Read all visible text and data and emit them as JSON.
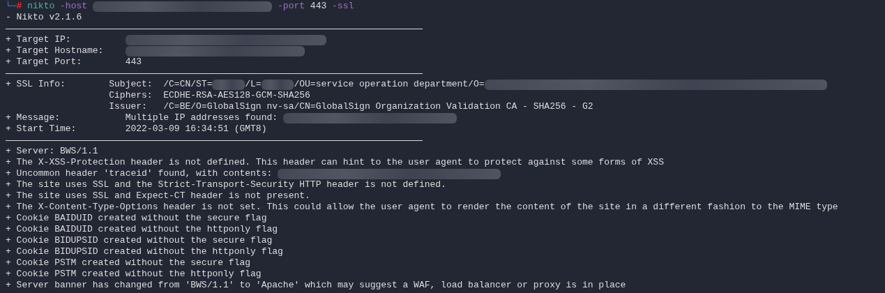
{
  "terminal": {
    "lines": [
      {
        "kind": "command",
        "segments": [
          {
            "kind": "prompt",
            "text": "└─"
          },
          {
            "kind": "root",
            "text": "#"
          },
          {
            "kind": "program",
            "text": " nikto"
          },
          {
            "kind": "option",
            "text": " -host "
          },
          {
            "kind": "redacted"
          },
          {
            "kind": "option",
            "text": " -port"
          },
          {
            "kind": "plain",
            "text": " 443"
          },
          {
            "kind": "option",
            "text": " -ssl"
          }
        ]
      },
      {
        "kind": "text",
        "segments": [
          {
            "kind": "plain",
            "text": "- Nikto v2.1.6"
          }
        ]
      },
      {
        "kind": "rule"
      },
      {
        "kind": "text",
        "segments": [
          {
            "kind": "plain",
            "text": "+ Target IP:          "
          },
          {
            "kind": "redacted"
          }
        ]
      },
      {
        "kind": "text",
        "segments": [
          {
            "kind": "plain",
            "text": "+ Target Hostname:    "
          },
          {
            "kind": "redacted"
          }
        ]
      },
      {
        "kind": "text",
        "segments": [
          {
            "kind": "plain",
            "text": "+ Target Port:        443"
          }
        ]
      },
      {
        "kind": "rule"
      },
      {
        "kind": "text",
        "segments": [
          {
            "kind": "plain",
            "text": "+ SSL Info:        Subject:  /C=CN/ST="
          },
          {
            "kind": "redacted"
          },
          {
            "kind": "plain",
            "text": "/L="
          },
          {
            "kind": "redacted"
          },
          {
            "kind": "plain",
            "text": "/OU=service operation department/O="
          },
          {
            "kind": "redacted"
          }
        ]
      },
      {
        "kind": "text",
        "segments": [
          {
            "kind": "plain",
            "text": "                   Ciphers:  ECDHE-RSA-AES128-GCM-SHA256"
          }
        ]
      },
      {
        "kind": "text",
        "segments": [
          {
            "kind": "plain",
            "text": "                   Issuer:   /C=BE/O=GlobalSign nv-sa/CN=GlobalSign Organization Validation CA - SHA256 - G2"
          }
        ]
      },
      {
        "kind": "text",
        "segments": [
          {
            "kind": "plain",
            "text": "+ Message:            Multiple IP addresses found: "
          },
          {
            "kind": "redacted"
          }
        ]
      },
      {
        "kind": "text",
        "segments": [
          {
            "kind": "plain",
            "text": "+ Start Time:         2022-03-09 16:34:51 (GMT8)"
          }
        ]
      },
      {
        "kind": "rule"
      },
      {
        "kind": "text",
        "segments": [
          {
            "kind": "plain",
            "text": "+ Server: BWS/1.1"
          }
        ]
      },
      {
        "kind": "text",
        "segments": [
          {
            "kind": "plain",
            "text": "+ The X-XSS-Protection header is not defined. This header can hint to the user agent to protect against some forms of XSS"
          }
        ]
      },
      {
        "kind": "text",
        "segments": [
          {
            "kind": "plain",
            "text": "+ Uncommon header 'traceid' found, with contents: "
          },
          {
            "kind": "redacted"
          }
        ]
      },
      {
        "kind": "text",
        "segments": [
          {
            "kind": "plain",
            "text": "+ The site uses SSL and the Strict-Transport-Security HTTP header is not defined."
          }
        ]
      },
      {
        "kind": "text",
        "segments": [
          {
            "kind": "plain",
            "text": "+ The site uses SSL and Expect-CT header is not present."
          }
        ]
      },
      {
        "kind": "text",
        "segments": [
          {
            "kind": "plain",
            "text": "+ The X-Content-Type-Options header is not set. This could allow the user agent to render the content of the site in a different fashion to the MIME type"
          }
        ]
      },
      {
        "kind": "text",
        "segments": [
          {
            "kind": "plain",
            "text": "+ Cookie BAIDUID created without the secure flag"
          }
        ]
      },
      {
        "kind": "text",
        "segments": [
          {
            "kind": "plain",
            "text": "+ Cookie BAIDUID created without the httponly flag"
          }
        ]
      },
      {
        "kind": "text",
        "segments": [
          {
            "kind": "plain",
            "text": "+ Cookie BIDUPSID created without the secure flag"
          }
        ]
      },
      {
        "kind": "text",
        "segments": [
          {
            "kind": "plain",
            "text": "+ Cookie BIDUPSID created without the httponly flag"
          }
        ]
      },
      {
        "kind": "text",
        "segments": [
          {
            "kind": "plain",
            "text": "+ Cookie PSTM created without the secure flag"
          }
        ]
      },
      {
        "kind": "text",
        "segments": [
          {
            "kind": "plain",
            "text": "+ Cookie PSTM created without the httponly flag"
          }
        ]
      },
      {
        "kind": "text",
        "segments": [
          {
            "kind": "plain",
            "text": "+ Server banner has changed from 'BWS/1.1' to 'Apache' which may suggest a WAF, load balancer or proxy is in place"
          }
        ]
      }
    ]
  }
}
